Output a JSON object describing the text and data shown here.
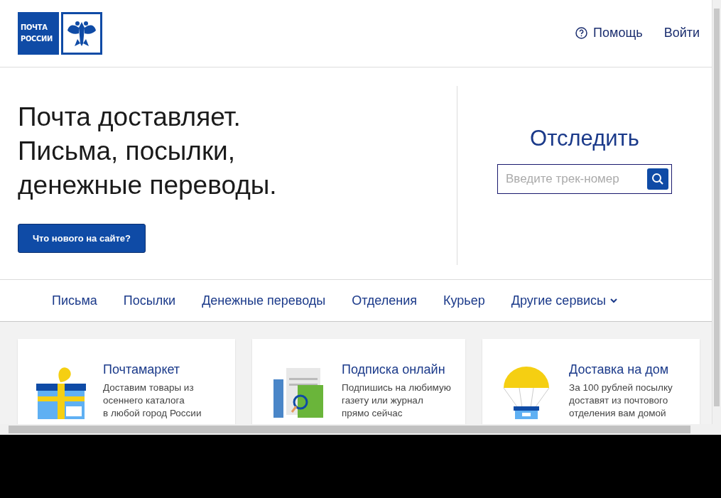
{
  "header": {
    "logo_lines": [
      "ПОЧТА",
      "РОССИИ"
    ],
    "help": "Помощь",
    "login": "Войти"
  },
  "hero": {
    "headline_lines": [
      "Почта доставляет.",
      "Письма, посылки,",
      "денежные переводы."
    ],
    "whats_new_button": "Что нового на сайте?"
  },
  "tracking": {
    "title": "Отследить",
    "placeholder": "Введите трек-номер"
  },
  "nav": {
    "items": [
      {
        "label": "Письма",
        "kind": "link"
      },
      {
        "label": "Посылки",
        "kind": "link"
      },
      {
        "label": "Денежные переводы",
        "kind": "link"
      },
      {
        "label": "Отделения",
        "kind": "link"
      },
      {
        "label": "Курьер",
        "kind": "link"
      },
      {
        "label": "Другие сервисы",
        "kind": "dropdown"
      }
    ]
  },
  "cards": [
    {
      "kind": "gift",
      "title": "Почтамаркет",
      "description_lines": [
        "Доставим товары из",
        "осеннего каталога",
        "в любой город России"
      ]
    },
    {
      "kind": "newspaper",
      "title": "Подписка онлайн",
      "description_lines": [
        "Подпишись на любимую",
        "газету или журнал",
        "прямо сейчас"
      ]
    },
    {
      "kind": "parachute",
      "title": "Доставка на дом",
      "description_lines": [
        "За 100 рублей посылку",
        "доставят из почтового",
        "отделения вам домой"
      ]
    }
  ]
}
